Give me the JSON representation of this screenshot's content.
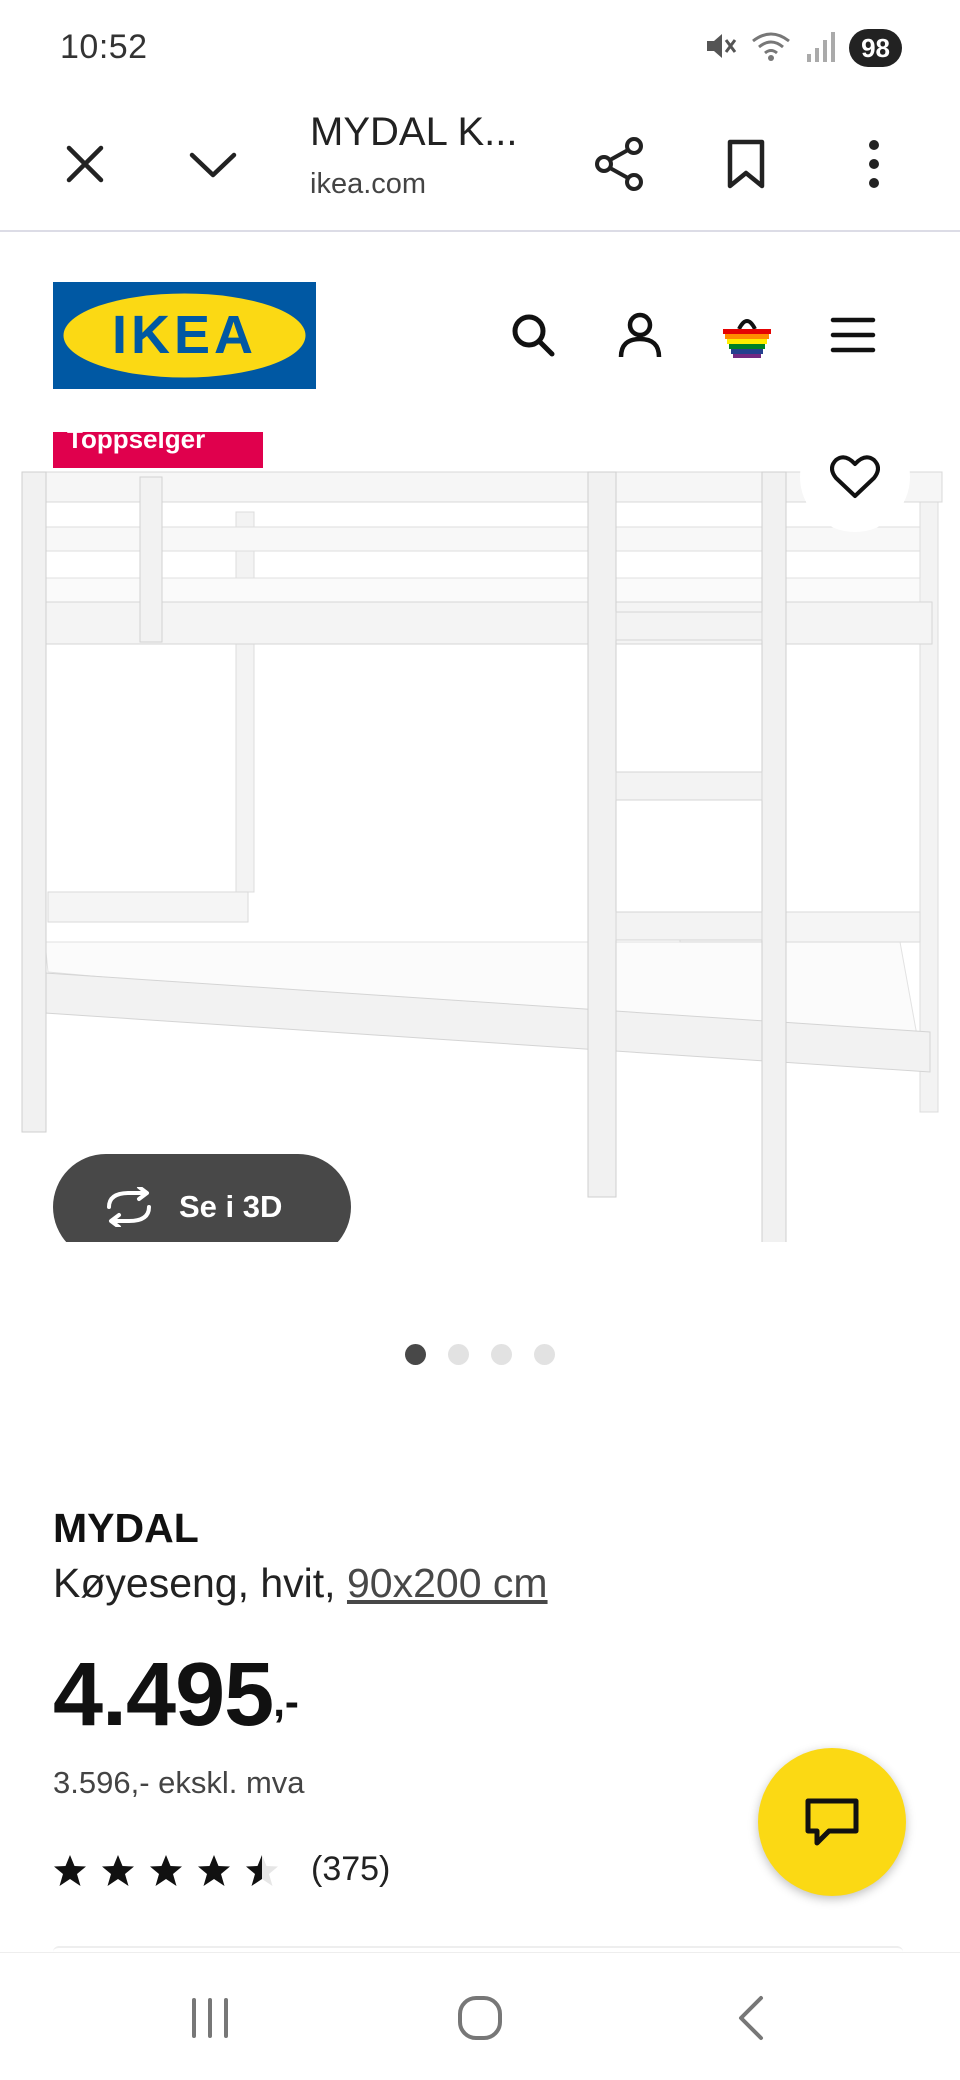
{
  "status_bar": {
    "time": "10:52",
    "battery": "98",
    "icons": [
      "mute-icon",
      "wifi-icon",
      "signal-icon"
    ]
  },
  "tab_bar": {
    "title": "MYDAL K...",
    "url": "ikea.com",
    "icons": [
      "close-icon",
      "chevron-down-icon",
      "share-icon",
      "bookmark-icon",
      "more-vert-icon"
    ]
  },
  "header": {
    "logo_text": "IKEA",
    "icons": [
      "search-icon",
      "account-icon",
      "cart-icon",
      "menu-icon"
    ],
    "brand_colors": {
      "blue": "#0058a3",
      "yellow": "#fbd914"
    }
  },
  "image": {
    "badge": "Toppselger",
    "view3d_label": "Se i 3D",
    "carousel": {
      "count": 4,
      "active": 1
    }
  },
  "product": {
    "name": "MYDAL",
    "desc": "Køyeseng, hvit,",
    "size": "90x200 cm",
    "price": "4.495",
    "price_suffix": ",-",
    "price_excl": "3.596,- ekskl. mva",
    "rating": 4.5,
    "rating_max": 5,
    "review_count": "(375)"
  },
  "chat": {
    "icon": "chat-icon"
  },
  "nav_bar": {
    "icons": [
      "recents-icon",
      "home-icon",
      "back-icon"
    ]
  }
}
